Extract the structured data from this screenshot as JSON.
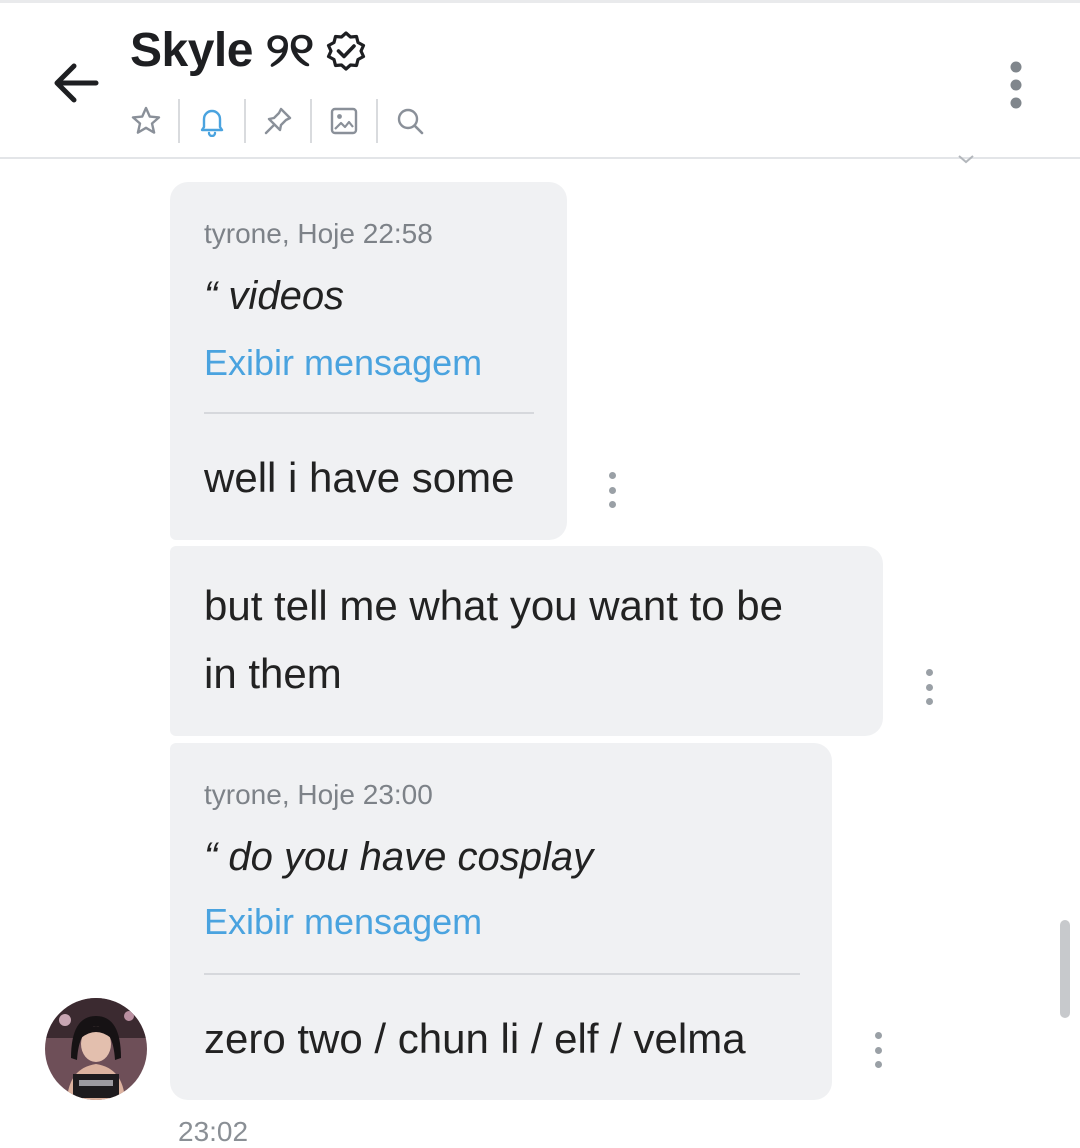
{
  "header": {
    "title": "Skyle ୨୧",
    "icons": {
      "back": "arrow-left-icon",
      "verified": "verified-badge-icon",
      "menu": "more-vertical-icon",
      "toolbar": [
        "star-icon",
        "bell-icon",
        "pin-icon",
        "image-icon",
        "search-icon"
      ]
    }
  },
  "messages": [
    {
      "reply_meta": "tyrone, Hoje 22:58",
      "reply_quote": "“ videos",
      "reply_link": "Exibir mensagem",
      "text": "well i have some"
    },
    {
      "text_line1": "but tell me what you want to be",
      "text_line2": "in them"
    },
    {
      "reply_meta": "tyrone, Hoje 23:00",
      "reply_quote": "“ do you have cosplay",
      "reply_link": "Exibir mensagem",
      "text": "zero two / chun li / elf / velma"
    }
  ],
  "footer_time": "23:02",
  "colors": {
    "accent": "#4aa3df",
    "bubble": "#f0f1f3",
    "meta_text": "#7d8288",
    "icon_gray": "#8a9099"
  }
}
